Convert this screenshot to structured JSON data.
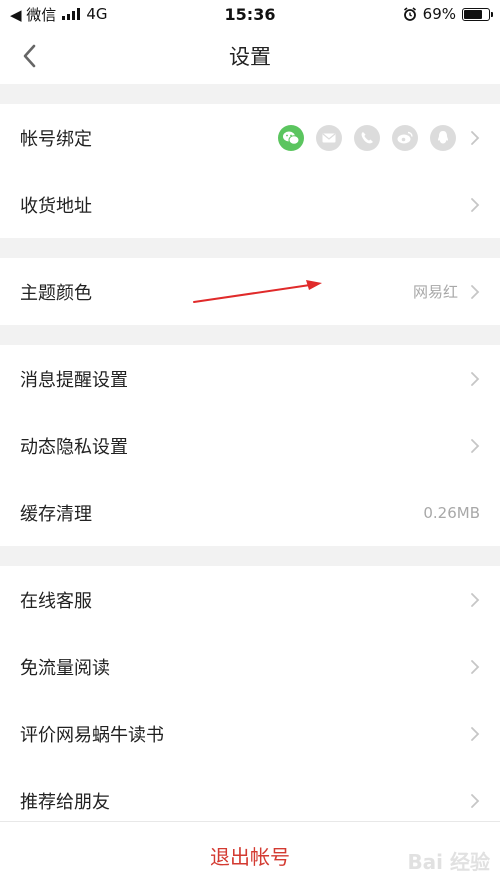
{
  "status": {
    "back_app": "◀ 微信",
    "network": "4G",
    "time": "15:36",
    "battery": "69%",
    "battery_level": 0.69
  },
  "nav": {
    "title": "设置"
  },
  "rows": {
    "account_binding": "帐号绑定",
    "address": "收货地址",
    "theme": "主题颜色",
    "theme_value": "网易红",
    "notifications": "消息提醒设置",
    "privacy": "动态隐私设置",
    "cache": "缓存清理",
    "cache_value": "0.26MB",
    "support": "在线客服",
    "free_data": "免流量阅读",
    "rate": "评价网易蜗牛读书",
    "recommend": "推荐给朋友"
  },
  "binding_icons": [
    "wechat-icon",
    "mail-icon",
    "phone-icon",
    "weibo-icon",
    "qq-icon"
  ],
  "logout": "退出帐号",
  "colors": {
    "accent": "#d33a31",
    "wechat": "#5bc55f",
    "arrow": "#e02a2a"
  },
  "watermark": "Bai 经验"
}
